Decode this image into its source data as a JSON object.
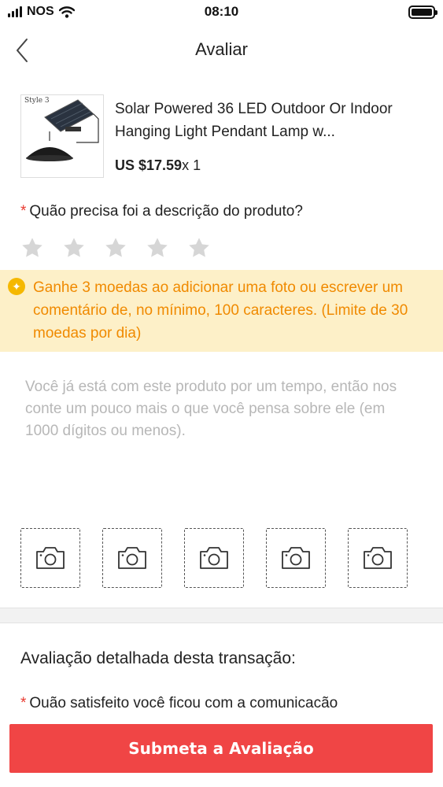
{
  "status_bar": {
    "carrier": "NOS",
    "time": "08:10"
  },
  "nav": {
    "title": "Avaliar"
  },
  "product": {
    "image_label": "Style 3",
    "title": "Solar Powered 36 LED Outdoor Or Indoor Hanging Light Pendant Lamp w...",
    "price": "US $17.59",
    "quantity": "x 1"
  },
  "rating": {
    "required_mark": "*",
    "question": "Quão precisa foi a descrição do produto?",
    "stars": 5,
    "selected": 0,
    "star_color": "#d6d6d6"
  },
  "coin_banner": {
    "icon": "coin-star-icon",
    "text": "Ganhe 3 moedas ao adicionar uma foto ou escrever um comentário de, no mínimo, 100 caracteres. (Limite de 30 moedas por dia)"
  },
  "review": {
    "placeholder": "Você já está com este produto por um tempo, então nos conte um pouco mais o que você pensa sobre ele (em 1000 dígitos ou menos).",
    "value": ""
  },
  "photos": {
    "slots": 5,
    "icon": "camera-icon"
  },
  "detailed": {
    "title": "Avaliação detalhada desta transação:",
    "required_mark": "*",
    "question": "Ouão satisfeito você ficou com a comunicacão"
  },
  "submit": {
    "label": "Submeta a Avaliação",
    "color": "#f04545"
  }
}
